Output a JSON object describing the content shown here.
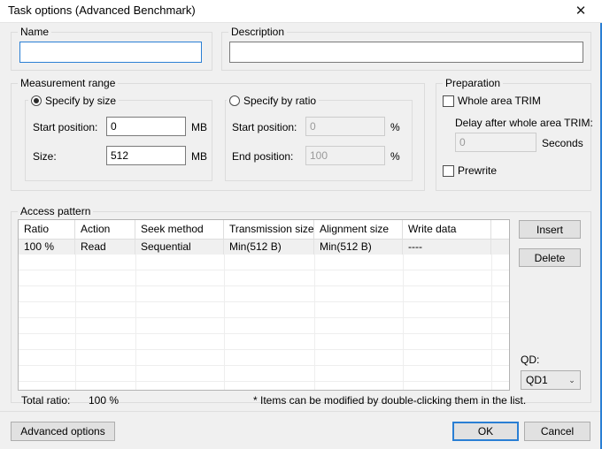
{
  "window": {
    "title": "Task options (Advanced Benchmark)",
    "close_icon": "close-icon",
    "close_glyph": "✕",
    "accent_color": "#2a7fd4",
    "background_color": "#f0f0f0"
  },
  "name_group": {
    "label": "Name",
    "value": "",
    "placeholder": ""
  },
  "description_group": {
    "label": "Description",
    "value": "",
    "placeholder": ""
  },
  "measurement_range": {
    "label": "Measurement range",
    "by_size": {
      "radio_label": "Specify by size",
      "selected": true,
      "start_position_label": "Start position:",
      "start_position_value": "0",
      "start_position_unit": "MB",
      "size_label": "Size:",
      "size_value": "512",
      "size_unit": "MB"
    },
    "by_ratio": {
      "radio_label": "Specify by ratio",
      "selected": false,
      "start_position_label": "Start position:",
      "start_position_value": "0",
      "start_position_unit": "%",
      "end_position_label": "End position:",
      "end_position_value": "100",
      "end_position_unit": "%"
    }
  },
  "preparation": {
    "label": "Preparation",
    "whole_area_trim_label": "Whole area TRIM",
    "whole_area_trim_checked": false,
    "delay_label": "Delay after whole area TRIM:",
    "delay_value": "0",
    "delay_unit": "Seconds",
    "prewrite_label": "Prewrite",
    "prewrite_checked": false
  },
  "access_pattern": {
    "label": "Access pattern",
    "columns": [
      "Ratio",
      "Action",
      "Seek method",
      "Transmission size",
      "Alignment size",
      "Write data"
    ],
    "rows": [
      {
        "ratio": "100 %",
        "action": "Read",
        "seek_method": "Sequential",
        "transmission_size": "Min(512 B)",
        "alignment_size": "Min(512 B)",
        "write_data": "----"
      }
    ],
    "empty_row_count": 9,
    "insert_label": "Insert",
    "delete_label": "Delete",
    "qd_label": "QD:",
    "qd_value": "QD1",
    "qd_arrow": "⌄",
    "total_ratio_label": "Total ratio:",
    "total_ratio_value": "100 %",
    "hint": "* Items can be modified by double-clicking them in the list."
  },
  "footer": {
    "advanced_options_label": "Advanced options",
    "ok_label": "OK",
    "cancel_label": "Cancel"
  }
}
